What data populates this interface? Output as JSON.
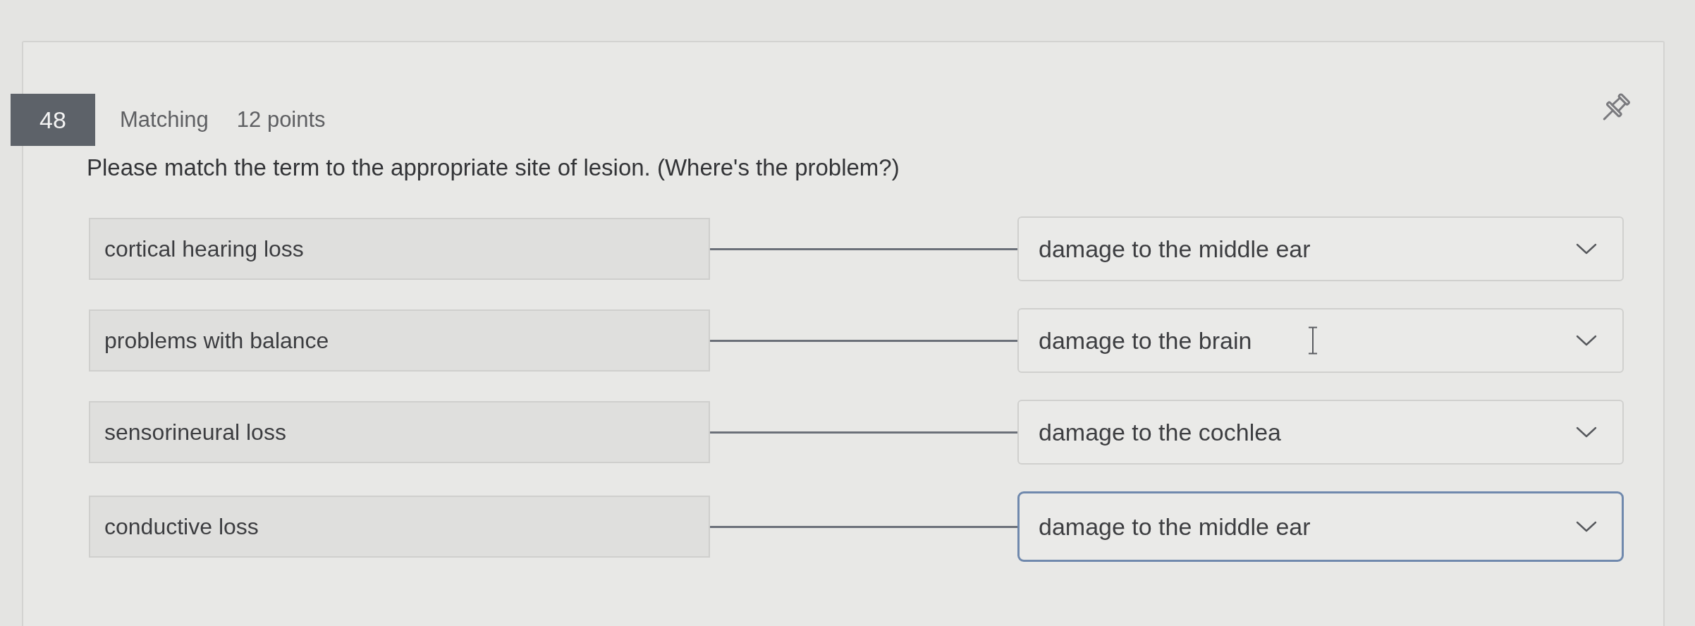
{
  "question": {
    "number": "48",
    "type": "Matching",
    "points": "12 points",
    "text": "Please match the term to the appropriate site of lesion. (Where's the problem?)"
  },
  "rows": [
    {
      "term": "cortical hearing loss",
      "answer": "damage to the middle ear",
      "focused": false,
      "hovered": false
    },
    {
      "term": "problems with balance",
      "answer": "damage to the brain",
      "focused": false,
      "hovered": true
    },
    {
      "term": "sensorineural loss",
      "answer": "damage to the cochlea",
      "focused": false,
      "hovered": false
    },
    {
      "term": "conductive loss",
      "answer": "damage to the middle ear",
      "focused": true,
      "hovered": false
    }
  ]
}
